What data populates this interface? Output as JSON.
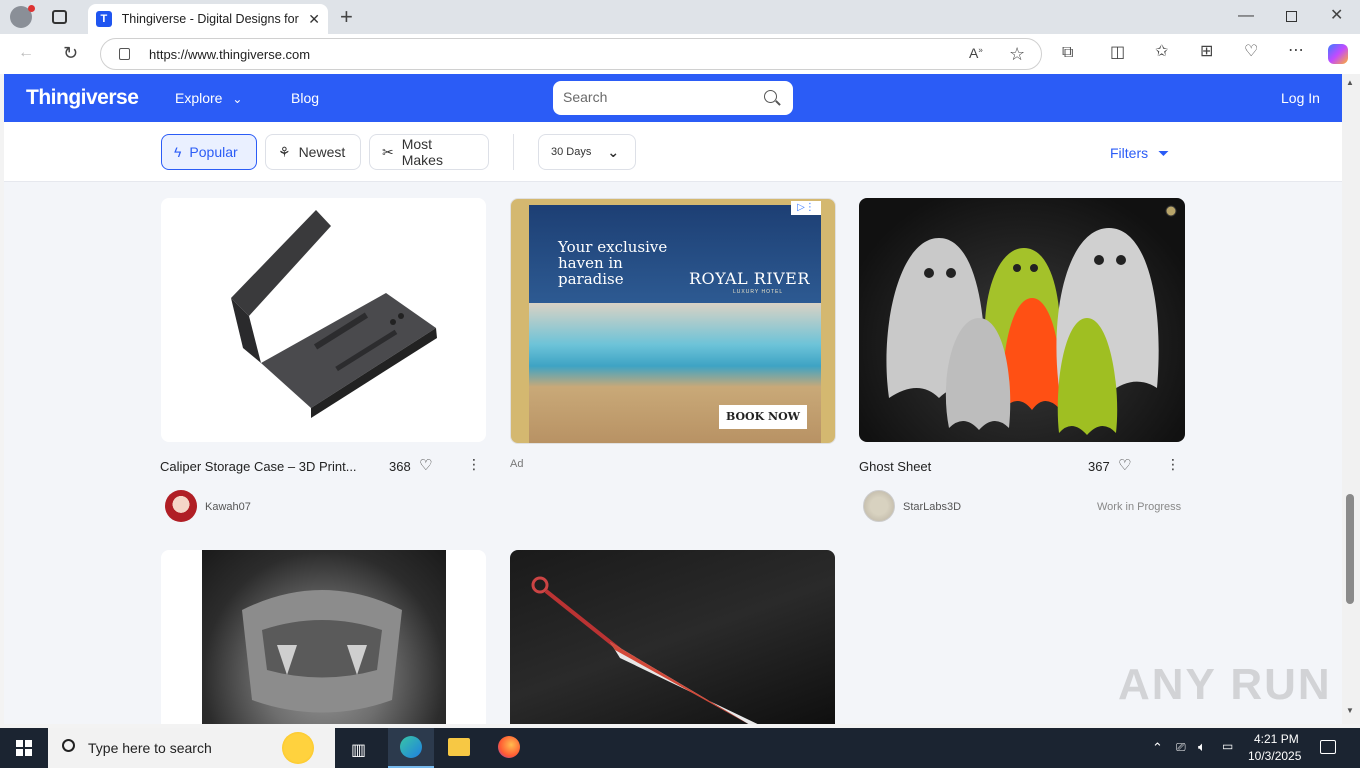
{
  "browser": {
    "tab_title": "Thingiverse - Digital Designs for Physical Objects",
    "tab_icon_letter": "T",
    "url": "https://www.thingiverse.com"
  },
  "site": {
    "logo": "Thingiverse",
    "nav": {
      "explore": "Explore",
      "blog": "Blog",
      "login": "Log In"
    },
    "search_placeholder": "Search",
    "accent": "#2b5cf6"
  },
  "filters": {
    "popular": "Popular",
    "newest": "Newest",
    "most_makes": "Most Makes",
    "period": "30 Days",
    "filters_label": "Filters"
  },
  "cards": {
    "c1": {
      "title": "Caliper Storage Case – 3D Print...",
      "likes": "368",
      "author": "Kawah07"
    },
    "ad": {
      "label": "Ad",
      "headline_1": "Your exclusive",
      "headline_2": "haven in",
      "headline_3": "paradise",
      "brand": "ROYAL RIVER",
      "brand_sub": "LUXURY HOTEL",
      "cta": "BOOK NOW"
    },
    "c3": {
      "title": "Ghost Sheet",
      "likes": "367",
      "author": "StarLabs3D",
      "status": "Work in Progress"
    }
  },
  "watermark": "ANY RUN",
  "taskbar": {
    "search_placeholder": "Type here to search",
    "time": "4:21 PM",
    "date": "10/3/2025"
  }
}
